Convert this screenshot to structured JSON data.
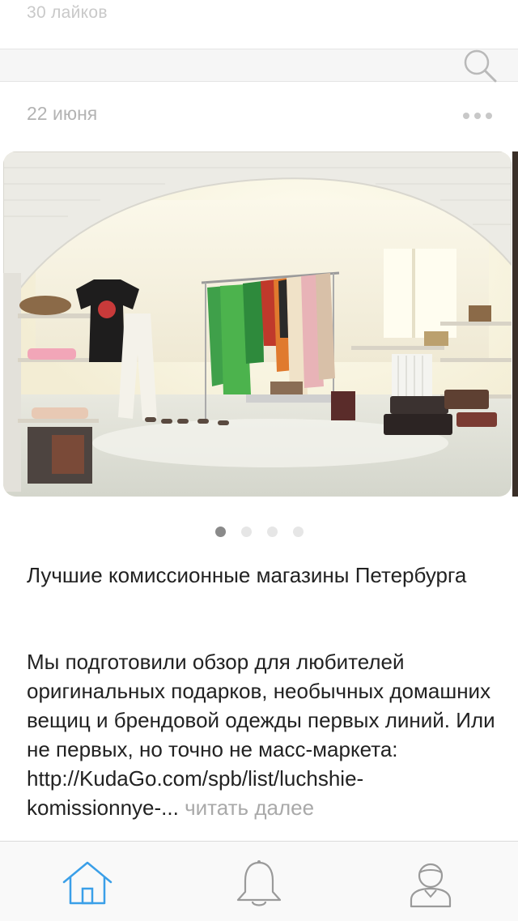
{
  "feed": {
    "previous_post": {
      "likes_text": "30 лайков"
    },
    "post": {
      "date": "22 июня",
      "photo_alt": "Интерьер комиссионного магазина",
      "pager": {
        "total": 4,
        "active": 0
      },
      "title": "Лучшие комиссионные магазины Петербурга",
      "body": "Мы подготовили обзор для любителей оригинальных подарков, необычных домашних вещиц и брендовой одежды первых линий. Или не первых, но точно не масс-маркета: http://KudaGo.com/spb/list/luchshie-komissionnye-...",
      "read_more": "читать далее"
    }
  },
  "icons": {
    "search": "search-icon",
    "more": "more-dots-icon",
    "home": "home-icon",
    "notifications": "bell-icon",
    "profile": "user-icon"
  },
  "colors": {
    "accent": "#3a9fe8",
    "inactive_icon": "#9a9a9a",
    "meta_text": "#b3b3b3",
    "pager_active": "#8a8a8a",
    "pager_inactive": "#e6e6e6"
  },
  "tabbar": {
    "active_tab": "home"
  }
}
